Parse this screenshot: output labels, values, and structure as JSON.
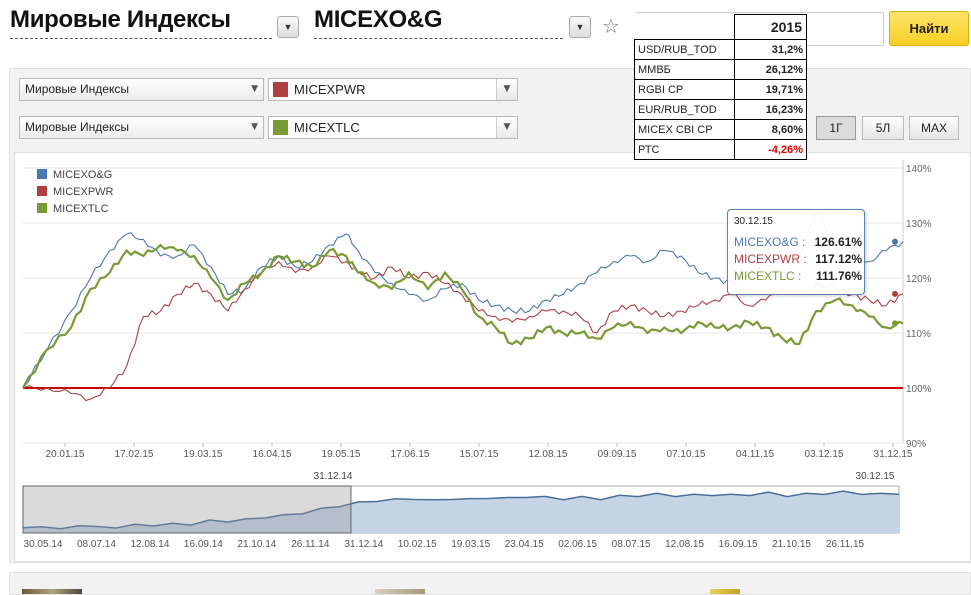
{
  "header": {
    "category": "Мировые Индексы",
    "instrument": "MICEXO&G",
    "search_placeholder": "",
    "search_button": "Найти"
  },
  "controls": {
    "row1": {
      "category": "Мировые Индексы",
      "symbol": "MICEXPWR",
      "color": "#b04040"
    },
    "row2": {
      "category": "Мировые Индексы",
      "symbol": "MICEXTLC",
      "color": "#7a9a35"
    },
    "periods": [
      "1Г",
      "5Л",
      "MAX"
    ],
    "active_period": "1Г"
  },
  "overlay_table": {
    "year": "2015",
    "rows": [
      {
        "label": "USD/RUB_TOD",
        "value": "31,2%",
        "negative": false
      },
      {
        "label": "ММВБ",
        "value": "26,12%",
        "negative": false
      },
      {
        "label": "RGBI CP",
        "value": "19,71%",
        "negative": false
      },
      {
        "label": "EUR/RUB_TOD",
        "value": "16,23%",
        "negative": false
      },
      {
        "label": "MICEX CBI CP",
        "value": "8,60%",
        "negative": false
      },
      {
        "label": "РТС",
        "value": "-4,26%",
        "negative": true
      }
    ]
  },
  "tooltip": {
    "date": "30.12.15",
    "rows": [
      {
        "label": "MICEXO&G :",
        "value": "126.61%",
        "color": "#4a78b0"
      },
      {
        "label": "MICEXPWR :",
        "value": "117.12%",
        "color": "#b04040"
      },
      {
        "label": "MICEXTLC :",
        "value": "111.76%",
        "color": "#7a9a35"
      }
    ]
  },
  "chart_data": {
    "type": "line",
    "title": "",
    "xlabel": "",
    "ylabel": "",
    "y_tick_labels": [
      "140%",
      "130%",
      "120%",
      "110%",
      "100%",
      "90%"
    ],
    "ylim": [
      90,
      140
    ],
    "x_tick_labels": [
      "20.01.15",
      "17.02.15",
      "19.03.15",
      "16.04.15",
      "19.05.15",
      "17.06.15",
      "15.07.15",
      "12.08.15",
      "09.09.15",
      "07.10.15",
      "04.11.15",
      "03.12.15",
      "31.12.15"
    ],
    "x_range": [
      "2014-12-31",
      "2015-12-31"
    ],
    "baseline": 100,
    "baseline_color": "#cc0000",
    "legend": "top-left",
    "series": [
      {
        "name": "MICEXO&G",
        "color": "#4a78b0",
        "points": [
          [
            "2014-12-31",
            100
          ],
          [
            "2015-01-10",
            107
          ],
          [
            "2015-01-20",
            114
          ],
          [
            "2015-01-28",
            120
          ],
          [
            "2015-02-05",
            125
          ],
          [
            "2015-02-12",
            128
          ],
          [
            "2015-02-19",
            127
          ],
          [
            "2015-02-26",
            124
          ],
          [
            "2015-03-05",
            124
          ],
          [
            "2015-03-12",
            126
          ],
          [
            "2015-03-19",
            122
          ],
          [
            "2015-03-26",
            117
          ],
          [
            "2015-04-02",
            118
          ],
          [
            "2015-04-09",
            122
          ],
          [
            "2015-04-16",
            124
          ],
          [
            "2015-04-23",
            122
          ],
          [
            "2015-04-30",
            123
          ],
          [
            "2015-05-07",
            126
          ],
          [
            "2015-05-14",
            128
          ],
          [
            "2015-05-19",
            125
          ],
          [
            "2015-05-26",
            121
          ],
          [
            "2015-06-02",
            119
          ],
          [
            "2015-06-09",
            117
          ],
          [
            "2015-06-17",
            116
          ],
          [
            "2015-06-24",
            118
          ],
          [
            "2015-07-01",
            119
          ],
          [
            "2015-07-08",
            116
          ],
          [
            "2015-07-15",
            115
          ],
          [
            "2015-07-22",
            114
          ],
          [
            "2015-07-29",
            114
          ],
          [
            "2015-08-05",
            116
          ],
          [
            "2015-08-12",
            117
          ],
          [
            "2015-08-19",
            119
          ],
          [
            "2015-08-26",
            121
          ],
          [
            "2015-09-02",
            123
          ],
          [
            "2015-09-09",
            124
          ],
          [
            "2015-09-16",
            123
          ],
          [
            "2015-09-23",
            125
          ],
          [
            "2015-09-30",
            124
          ],
          [
            "2015-10-07",
            121
          ],
          [
            "2015-10-14",
            120
          ],
          [
            "2015-10-21",
            119
          ],
          [
            "2015-10-28",
            121
          ],
          [
            "2015-11-04",
            120
          ],
          [
            "2015-11-11",
            122
          ],
          [
            "2015-11-18",
            124
          ],
          [
            "2015-11-25",
            132
          ],
          [
            "2015-12-03",
            126
          ],
          [
            "2015-12-10",
            124
          ],
          [
            "2015-12-17",
            123
          ],
          [
            "2015-12-24",
            125
          ],
          [
            "2015-12-31",
            126.61
          ]
        ]
      },
      {
        "name": "MICEXPWR",
        "color": "#b04040",
        "points": [
          [
            "2014-12-31",
            100
          ],
          [
            "2015-01-10",
            100
          ],
          [
            "2015-01-20",
            99
          ],
          [
            "2015-01-28",
            98
          ],
          [
            "2015-02-05",
            100
          ],
          [
            "2015-02-12",
            104
          ],
          [
            "2015-02-19",
            113
          ],
          [
            "2015-02-26",
            114
          ],
          [
            "2015-03-05",
            117
          ],
          [
            "2015-03-12",
            119
          ],
          [
            "2015-03-19",
            117
          ],
          [
            "2015-03-26",
            114
          ],
          [
            "2015-04-02",
            118
          ],
          [
            "2015-04-09",
            121
          ],
          [
            "2015-04-16",
            123
          ],
          [
            "2015-04-23",
            121
          ],
          [
            "2015-04-30",
            122
          ],
          [
            "2015-05-07",
            124
          ],
          [
            "2015-05-14",
            123
          ],
          [
            "2015-05-19",
            121
          ],
          [
            "2015-05-26",
            120
          ],
          [
            "2015-06-02",
            122
          ],
          [
            "2015-06-09",
            120
          ],
          [
            "2015-06-17",
            121
          ],
          [
            "2015-06-24",
            119
          ],
          [
            "2015-07-01",
            117
          ],
          [
            "2015-07-08",
            114
          ],
          [
            "2015-07-15",
            113
          ],
          [
            "2015-07-22",
            112
          ],
          [
            "2015-07-29",
            113
          ],
          [
            "2015-08-05",
            114
          ],
          [
            "2015-08-12",
            114
          ],
          [
            "2015-08-19",
            113
          ],
          [
            "2015-08-26",
            110
          ],
          [
            "2015-09-02",
            114
          ],
          [
            "2015-09-09",
            115
          ],
          [
            "2015-09-16",
            114
          ],
          [
            "2015-09-23",
            113
          ],
          [
            "2015-09-30",
            114
          ],
          [
            "2015-10-07",
            115
          ],
          [
            "2015-10-14",
            116
          ],
          [
            "2015-10-21",
            117
          ],
          [
            "2015-10-28",
            115
          ],
          [
            "2015-11-04",
            116
          ],
          [
            "2015-11-11",
            118
          ],
          [
            "2015-11-18",
            117
          ],
          [
            "2015-11-25",
            119
          ],
          [
            "2015-12-03",
            118
          ],
          [
            "2015-12-10",
            117
          ],
          [
            "2015-12-17",
            116
          ],
          [
            "2015-12-24",
            115
          ],
          [
            "2015-12-31",
            117.12
          ]
        ]
      },
      {
        "name": "MICEXTLC",
        "color": "#7a9a35",
        "points": [
          [
            "2014-12-31",
            100
          ],
          [
            "2015-01-10",
            107
          ],
          [
            "2015-01-20",
            111
          ],
          [
            "2015-01-28",
            118
          ],
          [
            "2015-02-05",
            121
          ],
          [
            "2015-02-12",
            125
          ],
          [
            "2015-02-19",
            124
          ],
          [
            "2015-02-26",
            126
          ],
          [
            "2015-03-05",
            125
          ],
          [
            "2015-03-12",
            124
          ],
          [
            "2015-03-19",
            120
          ],
          [
            "2015-03-26",
            116
          ],
          [
            "2015-04-02",
            119
          ],
          [
            "2015-04-09",
            121
          ],
          [
            "2015-04-16",
            124
          ],
          [
            "2015-04-23",
            123
          ],
          [
            "2015-04-30",
            122
          ],
          [
            "2015-05-07",
            125
          ],
          [
            "2015-05-14",
            124
          ],
          [
            "2015-05-19",
            121
          ],
          [
            "2015-05-26",
            119
          ],
          [
            "2015-06-02",
            118
          ],
          [
            "2015-06-09",
            121
          ],
          [
            "2015-06-17",
            118
          ],
          [
            "2015-06-24",
            121
          ],
          [
            "2015-07-01",
            118
          ],
          [
            "2015-07-08",
            113
          ],
          [
            "2015-07-15",
            111
          ],
          [
            "2015-07-22",
            108
          ],
          [
            "2015-07-29",
            109
          ],
          [
            "2015-08-05",
            111
          ],
          [
            "2015-08-12",
            110
          ],
          [
            "2015-08-19",
            110
          ],
          [
            "2015-08-26",
            109
          ],
          [
            "2015-09-02",
            111
          ],
          [
            "2015-09-09",
            112
          ],
          [
            "2015-09-16",
            110
          ],
          [
            "2015-09-23",
            111
          ],
          [
            "2015-09-30",
            110
          ],
          [
            "2015-10-07",
            112
          ],
          [
            "2015-10-14",
            111
          ],
          [
            "2015-10-21",
            111
          ],
          [
            "2015-10-28",
            112
          ],
          [
            "2015-11-04",
            111
          ],
          [
            "2015-11-11",
            109
          ],
          [
            "2015-11-18",
            108
          ],
          [
            "2015-11-25",
            114
          ],
          [
            "2015-12-03",
            116
          ],
          [
            "2015-12-10",
            115
          ],
          [
            "2015-12-17",
            113
          ],
          [
            "2015-12-24",
            111
          ],
          [
            "2015-12-31",
            111.76
          ]
        ]
      }
    ]
  },
  "navigator": {
    "start_label": "31.12.14",
    "end_label": "30.12.15",
    "x_tick_labels": [
      "30.05.14",
      "08.07.14",
      "12.08.14",
      "16.09.14",
      "21.10.14",
      "26.11.14",
      "31.12.14",
      "10.02.15",
      "19.03.15",
      "23.04.15",
      "02.06.15",
      "08.07.15",
      "12.08.15",
      "16.09.15",
      "21.10.15",
      "26.11.15"
    ],
    "values": [
      100,
      101,
      99,
      102,
      101,
      100,
      103,
      102,
      104,
      103,
      107,
      106,
      108,
      110,
      112,
      114,
      118,
      121,
      124,
      126,
      127,
      128,
      126,
      128,
      127,
      129,
      128,
      130,
      129,
      128,
      129,
      128,
      130,
      131,
      132,
      131,
      131,
      132,
      131,
      132,
      133,
      131,
      132,
      133,
      134,
      133,
      132,
      133
    ]
  }
}
